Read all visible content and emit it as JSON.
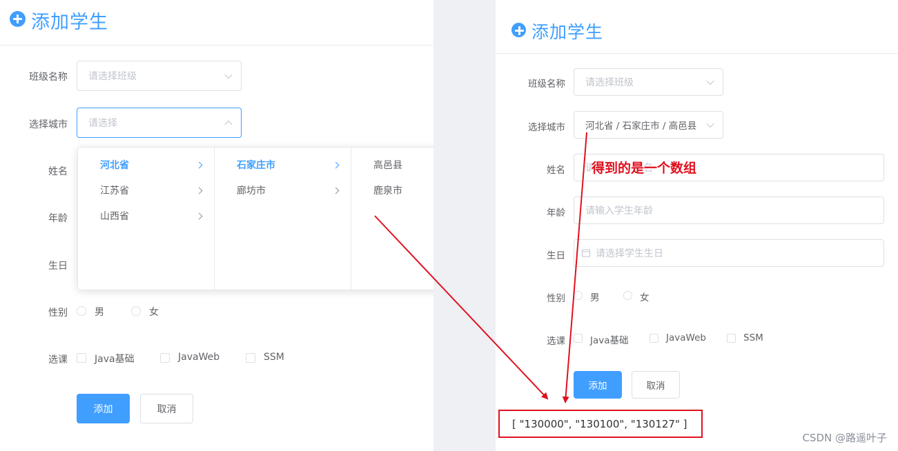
{
  "header": {
    "title": "添加学生",
    "icon": "plus-circle-icon"
  },
  "form": {
    "class_label": "班级名称",
    "class_placeholder": "请选择班级",
    "city_label": "选择城市",
    "city_placeholder": "请选择",
    "city_value": "河北省 / 石家庄市 / 高邑县",
    "name_label": "姓名",
    "name_placeholder": "请输入学生姓名",
    "age_label": "年龄",
    "age_placeholder": "请输入学生年龄",
    "birthday_label": "生日",
    "birthday_placeholder": "请选择学生生日",
    "gender_label": "性别",
    "gender_options": [
      "男",
      "女"
    ],
    "course_label": "选课",
    "course_options": [
      "Java基础",
      "JavaWeb",
      "SSM"
    ],
    "submit_label": "添加",
    "cancel_label": "取消"
  },
  "cascader": {
    "provinces": [
      "河北省",
      "江苏省",
      "山西省"
    ],
    "cities": [
      "石家庄市",
      "廊坊市"
    ],
    "counties": [
      "高邑县",
      "鹿泉市"
    ],
    "active_province": "河北省",
    "active_city": "石家庄市"
  },
  "annotation": {
    "note": "得到的是一个数组",
    "result": "[ \"130000\", \"130100\", \"130127\" ]",
    "color": "#e0101e"
  },
  "watermark": "CSDN @路遥叶子",
  "colors": {
    "primary": "#409eff",
    "border": "#dcdfe6",
    "placeholder": "#c0c4cc",
    "text": "#606266"
  }
}
